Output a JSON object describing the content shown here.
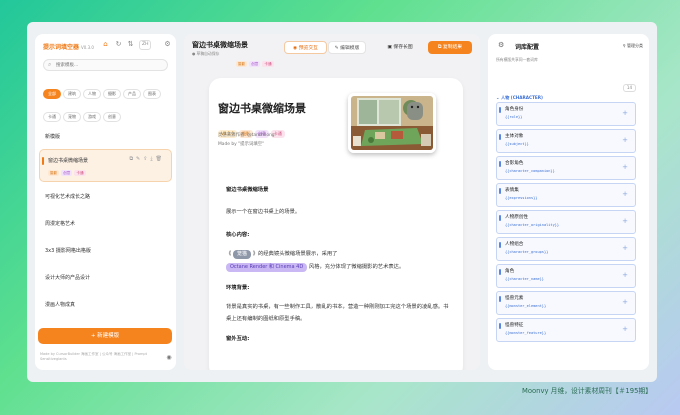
{
  "brand": {
    "name": "提示词填空器",
    "version": "V0.3.0",
    "lang": "ZH"
  },
  "left": {
    "search_placeholder": "搜索模板...",
    "categories": [
      {
        "label": "全部",
        "active": true
      },
      {
        "label": "建筑",
        "active": false
      },
      {
        "label": "人物",
        "active": false
      },
      {
        "label": "摄影",
        "active": false
      },
      {
        "label": "产品",
        "active": false
      },
      {
        "label": "图表",
        "active": false
      },
      {
        "label": "卡通",
        "active": false
      },
      {
        "label": "宠物",
        "active": false
      },
      {
        "label": "游戏",
        "active": false
      },
      {
        "label": "创意",
        "active": false
      }
    ],
    "templates": [
      {
        "name": "新模版"
      },
      {
        "name": "窗边书桌微缩场景",
        "selected": true,
        "tags": [
          "摄影",
          "创意",
          "卡通"
        ]
      },
      {
        "name": "可视化艺术成长之路"
      },
      {
        "name": "周漫定格艺术"
      },
      {
        "name": "3x3 摄影网格出格版"
      },
      {
        "name": "设计大师的产品设计"
      },
      {
        "name": "漫画人物成真"
      },
      {
        "name": "杂志大片"
      }
    ],
    "new_button": "+ 新建模版",
    "footer": "Made by CursorBuilder 海画工作室 | 公众号 海画工作室 | Prompt Sensitiveglants"
  },
  "mid": {
    "header_title": "窗边书桌微缩场景",
    "header_sub": "● 草稿自动保存",
    "header_tags": [
      "摄影",
      "创意",
      "卡通"
    ],
    "toolbar": {
      "preview": "预览交互",
      "edit": "编辑模版",
      "save": "保存长图",
      "copy": "复制结果"
    },
    "card": {
      "title": "窗边书桌微缩场景",
      "version": "V0.3.0",
      "tags": [
        "摄影",
        "创意",
        "卡通"
      ],
      "author": "灵感来源作者: @tanshilong",
      "made": "Made by \"提示词填空\"",
      "h1": "窗边书桌微缩场景",
      "intro": "展示一个在窗边书桌上的场景。",
      "core_label": "核心内容:",
      "core_pre": "《",
      "slot1": "笼猫",
      "core_post": "》的经典镜头微缩场景展示，采用了",
      "slot2": "Octane Render 和 Cinema 4D",
      "core_tail": "风格，充分体现了微缩摄影的艺术表达。",
      "env_label": "环境背景:",
      "env_text": "背景是真实的书桌，有一些制作工具，散乱的书本，营造一种刚刚加工完这个场景的凌乱感。书桌上还有编制的图纸和原型手稿。",
      "outside_label": "窗外互动:"
    }
  },
  "right": {
    "title": "词库配置",
    "manage": "管理分类",
    "subtitle": "所有模版共享同一套词库",
    "group": "人物 (CHARACTER)",
    "group_count": "14",
    "items": [
      {
        "name": "角色身份",
        "key": "{{role}}"
      },
      {
        "name": "主体对象",
        "key": "{{subject}}"
      },
      {
        "name": "合影角色",
        "key": "{{character_companion}}"
      },
      {
        "name": "表情集",
        "key": "{{expressions}}"
      },
      {
        "name": "人物原创性",
        "key": "{{character_originality}}"
      },
      {
        "name": "人物组合",
        "key": "{{character_groups}}"
      },
      {
        "name": "角色",
        "key": "{{character_name}}"
      },
      {
        "name": "怪兽元素",
        "key": "{{monster_element}}"
      },
      {
        "name": "怪兽特征",
        "key": "{{monster_feature}}"
      }
    ]
  },
  "credit": "Moonvy 月维，设计素材周刊【＃195期】"
}
